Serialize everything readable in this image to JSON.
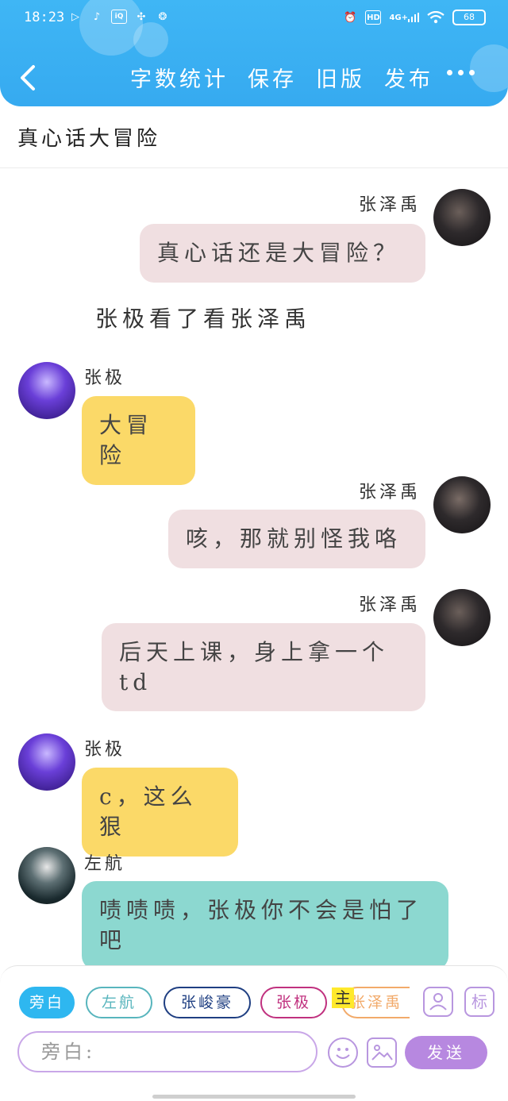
{
  "status_bar": {
    "time": "18:23",
    "network": "4G+",
    "hd": "HD",
    "battery": "68"
  },
  "header": {
    "actions": [
      "字数统计",
      "保存",
      "旧版",
      "发布"
    ],
    "back_icon": "chevron-left-icon",
    "more_icon": "more-dots-icon"
  },
  "title": "真心话大冒险",
  "messages": [
    {
      "side": "right",
      "name": "张泽禹",
      "text": "真心话还是大冒险？",
      "color": "#f0dfe1"
    },
    {
      "side": "narration",
      "text": "张极看了看张泽禹"
    },
    {
      "side": "left",
      "name": "张极",
      "text": "大冒险",
      "color": "#fbd968"
    },
    {
      "side": "right",
      "name": "张泽禹",
      "text": "咳，那就别怪我咯",
      "color": "#f0dfe1"
    },
    {
      "side": "right",
      "name": "张泽禹",
      "text": "后天上课，身上拿一个td",
      "color": "#f0dfe1"
    },
    {
      "side": "left",
      "name": "张极",
      "text": "c，这么狠",
      "color": "#fbd968"
    },
    {
      "side": "left",
      "name": "左航",
      "text": "啧啧啧，张极你不会是怕了吧",
      "color": "#8cd8d0"
    }
  ],
  "roles": [
    {
      "label": "旁白",
      "color": "#2eb7f0",
      "selected": true
    },
    {
      "label": "左航",
      "color": "#58b5bd"
    },
    {
      "label": "张峻豪",
      "color": "#1f3f82"
    },
    {
      "label": "张极",
      "color": "#c0317f"
    },
    {
      "label": "张泽禹",
      "color": "#f2aa6a"
    }
  ],
  "main_tag": "主",
  "mark_label": "标",
  "input": {
    "value": "旁白:"
  },
  "send_label": "发送"
}
